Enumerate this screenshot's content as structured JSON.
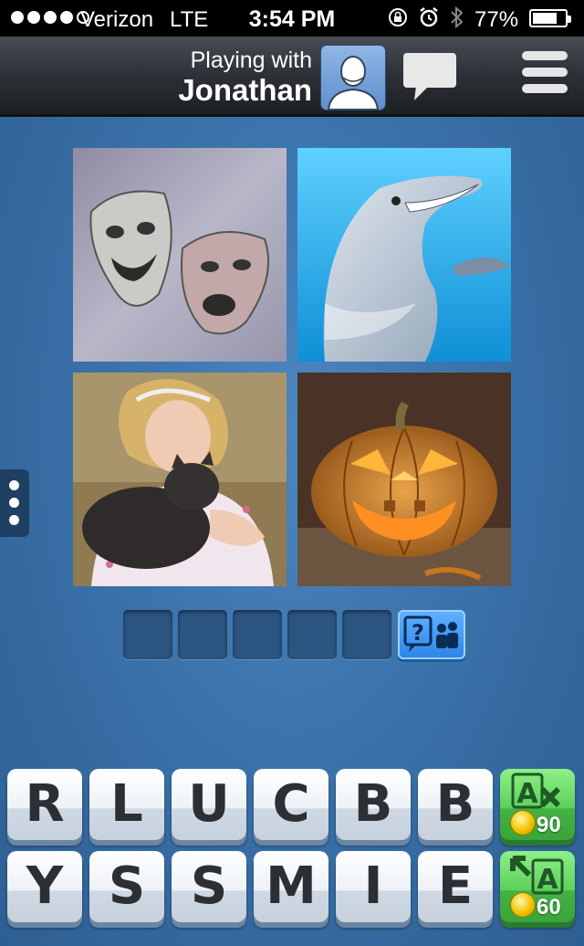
{
  "status_bar": {
    "carrier": "Verizon",
    "network": "LTE",
    "time": "3:54 PM",
    "battery_percent": "77%",
    "battery_level": 0.77,
    "signal_bars": 4,
    "signal_max": 5,
    "icons": [
      "orientation-lock-icon",
      "alarm-icon",
      "bluetooth-icon"
    ]
  },
  "header": {
    "playing_with_label": "Playing with",
    "opponent_name": "Jonathan",
    "avatar_icon": "person-silhouette-icon",
    "chat_icon": "speech-bubble-icon",
    "menu_icon": "hamburger-menu-icon"
  },
  "puzzle": {
    "pictures": [
      {
        "subject": "theater-masks"
      },
      {
        "subject": "dolphin"
      },
      {
        "subject": "girl-hugging-cat"
      },
      {
        "subject": "jack-o-lantern"
      }
    ],
    "answer_length": 5,
    "answer_slots": [
      "",
      "",
      "",
      "",
      ""
    ],
    "ask_friend_icon": "question-friends-icon"
  },
  "letters": {
    "row1": [
      "R",
      "L",
      "U",
      "C",
      "B",
      "B"
    ],
    "row2": [
      "Y",
      "S",
      "S",
      "M",
      "I",
      "E"
    ]
  },
  "powerups": {
    "remove_letter": {
      "icon": "remove-letter-icon",
      "cost": "90"
    },
    "reveal_letter": {
      "icon": "reveal-letter-icon",
      "cost": "60"
    }
  },
  "colors": {
    "background": "#3a72aa",
    "top_bar": "#2d3137",
    "ask_button": "#2f86e8",
    "powerup": "#5dd05a"
  }
}
